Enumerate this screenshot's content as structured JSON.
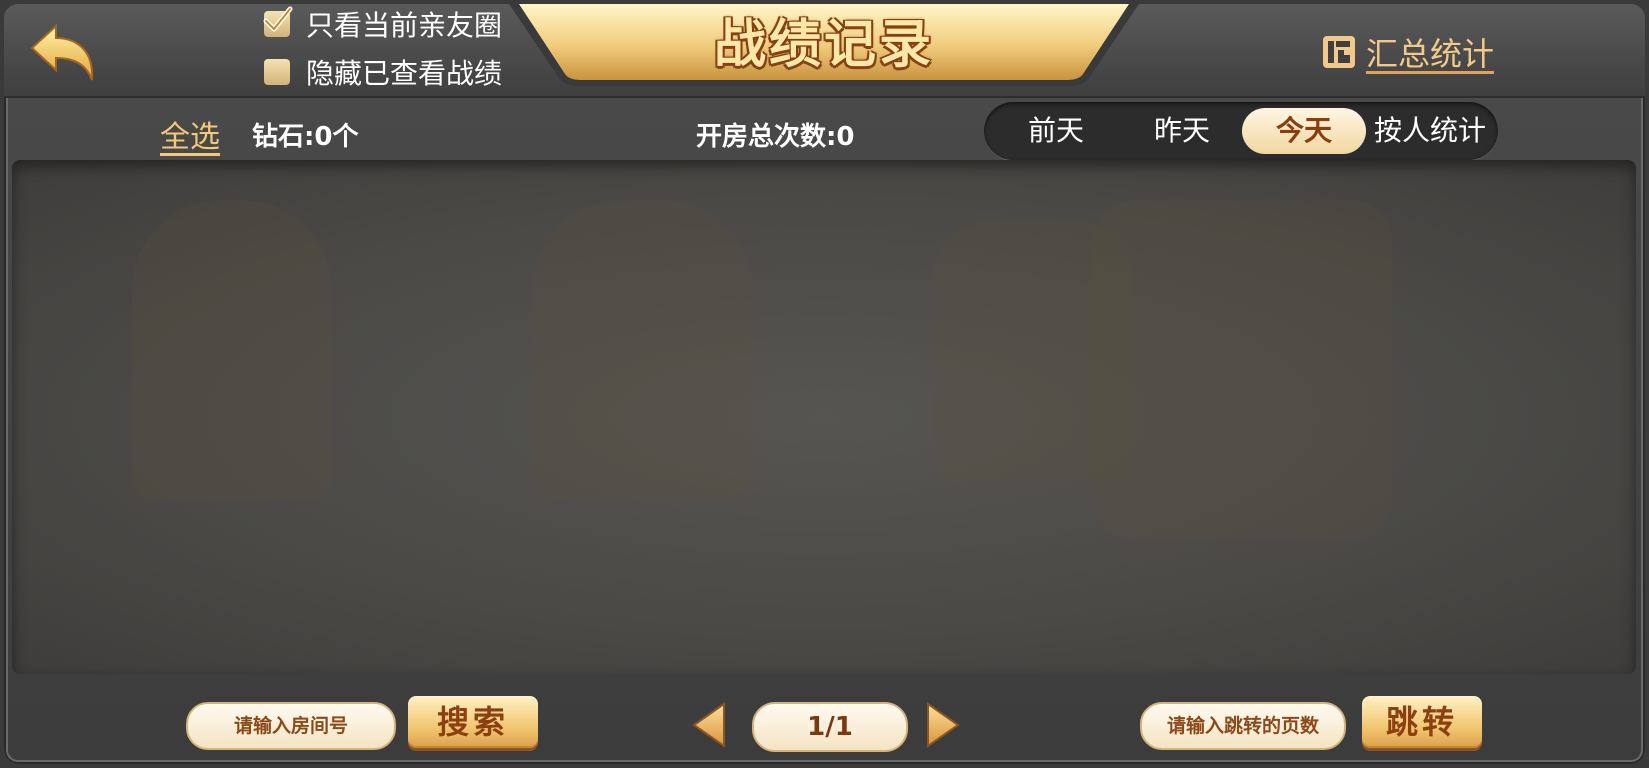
{
  "header": {
    "title": "战绩记录",
    "filters": [
      {
        "label": "只看当前亲友圈",
        "checked": true
      },
      {
        "label": "隐藏已查看战绩",
        "checked": false
      }
    ],
    "stats_link": "汇总统计"
  },
  "toolbar": {
    "select_all": "全选",
    "diamonds": "钻石:0个",
    "room_total": "开房总次数:0",
    "tabs": [
      {
        "label": "前天",
        "active": false
      },
      {
        "label": "昨天",
        "active": false
      },
      {
        "label": "今天",
        "active": true
      },
      {
        "label": "按人统计",
        "active": false
      }
    ]
  },
  "footer": {
    "room_search_placeholder": "请输入房间号",
    "search_button": "搜索",
    "page_indicator": "1/1",
    "jump_placeholder": "请输入跳转的页数",
    "jump_button": "跳转"
  },
  "colors": {
    "accent_gold": "#f2c879",
    "title_text": "#fbe7a7",
    "button_text": "#8d3f11"
  },
  "icons": {
    "back": "back-arrow-icon",
    "stats": "stats-icon",
    "check": "checkmark-icon",
    "prev": "triangle-left-icon",
    "next": "triangle-right-icon"
  }
}
